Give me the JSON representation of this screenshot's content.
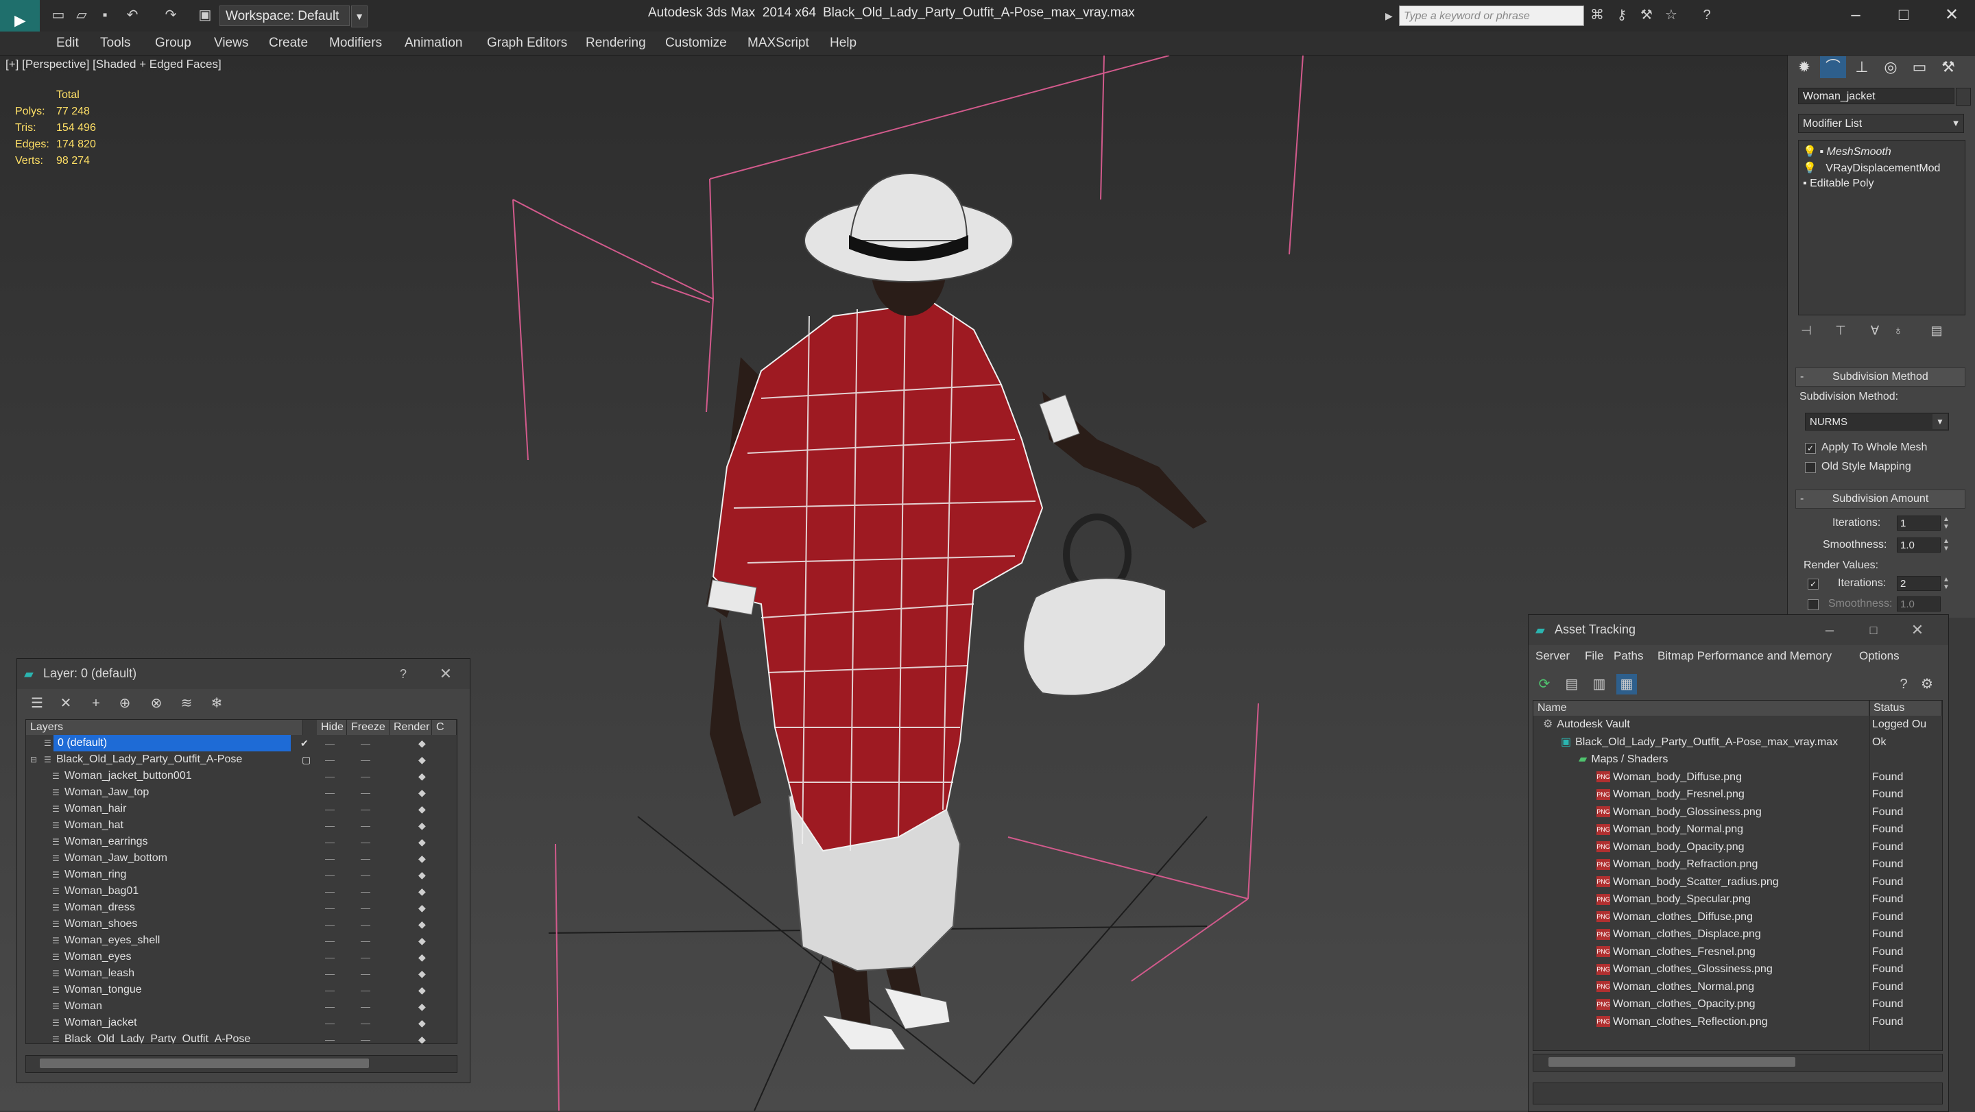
{
  "titlebar": {
    "app_title": "Autodesk 3ds Max  2014 x64",
    "file_title": "Black_Old_Lady_Party_Outfit_A-Pose_max_vray.max",
    "workspace": "Workspace: Default",
    "search_placeholder": "Type a keyword or phrase"
  },
  "menu": [
    "Edit",
    "Tools",
    "Group",
    "Views",
    "Create",
    "Modifiers",
    "Animation",
    "Graph Editors",
    "Rendering",
    "Customize",
    "MAXScript",
    "Help"
  ],
  "viewport": {
    "label": "[+] [Perspective] [Shaded + Edged Faces]",
    "stats": {
      "header": "Total",
      "polys_label": "Polys:",
      "polys": "77 248",
      "tris_label": "Tris:",
      "tris": "154 496",
      "edges_label": "Edges:",
      "edges": "174 820",
      "verts_label": "Verts:",
      "verts": "98 274"
    }
  },
  "command_panel": {
    "object_name": "Woman_jacket",
    "modifier_list": "Modifier List",
    "stack": [
      "MeshSmooth",
      "VRayDisplacementMod",
      "Editable Poly"
    ],
    "subdivision_method_title": "Subdivision Method",
    "subdivision_method_label": "Subdivision Method:",
    "subdivision_method_value": "NURMS",
    "apply_whole_mesh": "Apply To Whole Mesh",
    "old_style_mapping": "Old Style Mapping",
    "subdivision_amount_title": "Subdivision Amount",
    "iterations_label": "Iterations:",
    "iterations": "1",
    "smoothness_label": "Smoothness:",
    "smoothness": "1.0",
    "render_values_label": "Render Values:",
    "render_iterations_label": "Iterations:",
    "render_iterations": "2",
    "render_smoothness_label": "Smoothness:",
    "render_smoothness": "1.0"
  },
  "layer_window": {
    "title": "Layer: 0 (default)",
    "help": "?",
    "columns": [
      "Layers",
      "Hide",
      "Freeze",
      "Render",
      "C"
    ],
    "rows": [
      {
        "name": "0 (default)",
        "level": 0,
        "selected": true
      },
      {
        "name": "Black_Old_Lady_Party_Outfit_A-Pose",
        "level": 0
      },
      {
        "name": "Woman_jacket_button001",
        "level": 1
      },
      {
        "name": "Woman_Jaw_top",
        "level": 1
      },
      {
        "name": "Woman_hair",
        "level": 1
      },
      {
        "name": "Woman_hat",
        "level": 1
      },
      {
        "name": "Woman_earrings",
        "level": 1
      },
      {
        "name": "Woman_Jaw_bottom",
        "level": 1
      },
      {
        "name": "Woman_ring",
        "level": 1
      },
      {
        "name": "Woman_bag01",
        "level": 1
      },
      {
        "name": "Woman_dress",
        "level": 1
      },
      {
        "name": "Woman_shoes",
        "level": 1
      },
      {
        "name": "Woman_eyes_shell",
        "level": 1
      },
      {
        "name": "Woman_eyes",
        "level": 1
      },
      {
        "name": "Woman_leash",
        "level": 1
      },
      {
        "name": "Woman_tongue",
        "level": 1
      },
      {
        "name": "Woman",
        "level": 1
      },
      {
        "name": "Woman_jacket",
        "level": 1
      },
      {
        "name": "Black_Old_Lady_Party_Outfit_A-Pose",
        "level": 1
      }
    ]
  },
  "asset_window": {
    "title": "Asset Tracking",
    "menu": [
      "Server",
      "File",
      "Paths",
      "Bitmap Performance and Memory",
      "Options"
    ],
    "columns": [
      "Name",
      "Status"
    ],
    "rows": [
      {
        "name": "Autodesk Vault",
        "status": "Logged Ou",
        "level": 0,
        "type": "vault"
      },
      {
        "name": "Black_Old_Lady_Party_Outfit_A-Pose_max_vray.max",
        "status": "Ok",
        "level": 1,
        "type": "max"
      },
      {
        "name": "Maps / Shaders",
        "status": "",
        "level": 2,
        "type": "folder"
      },
      {
        "name": "Woman_body_Diffuse.png",
        "status": "Found",
        "level": 3,
        "type": "png"
      },
      {
        "name": "Woman_body_Fresnel.png",
        "status": "Found",
        "level": 3,
        "type": "png"
      },
      {
        "name": "Woman_body_Glossiness.png",
        "status": "Found",
        "level": 3,
        "type": "png"
      },
      {
        "name": "Woman_body_Normal.png",
        "status": "Found",
        "level": 3,
        "type": "png"
      },
      {
        "name": "Woman_body_Opacity.png",
        "status": "Found",
        "level": 3,
        "type": "png"
      },
      {
        "name": "Woman_body_Refraction.png",
        "status": "Found",
        "level": 3,
        "type": "png"
      },
      {
        "name": "Woman_body_Scatter_radius.png",
        "status": "Found",
        "level": 3,
        "type": "png"
      },
      {
        "name": "Woman_body_Specular.png",
        "status": "Found",
        "level": 3,
        "type": "png"
      },
      {
        "name": "Woman_clothes_Diffuse.png",
        "status": "Found",
        "level": 3,
        "type": "png"
      },
      {
        "name": "Woman_clothes_Displace.png",
        "status": "Found",
        "level": 3,
        "type": "png"
      },
      {
        "name": "Woman_clothes_Fresnel.png",
        "status": "Found",
        "level": 3,
        "type": "png"
      },
      {
        "name": "Woman_clothes_Glossiness.png",
        "status": "Found",
        "level": 3,
        "type": "png"
      },
      {
        "name": "Woman_clothes_Normal.png",
        "status": "Found",
        "level": 3,
        "type": "png"
      },
      {
        "name": "Woman_clothes_Opacity.png",
        "status": "Found",
        "level": 3,
        "type": "png"
      },
      {
        "name": "Woman_clothes_Reflection.png",
        "status": "Found",
        "level": 3,
        "type": "png"
      }
    ]
  },
  "colors": {
    "viewport_bg": "#3a3a3a",
    "stats_yellow": "#ffe066",
    "selection_blue": "#1e6bd6",
    "jacket_red": "#9e1a22",
    "bounding_pink": "#d25a8c"
  }
}
